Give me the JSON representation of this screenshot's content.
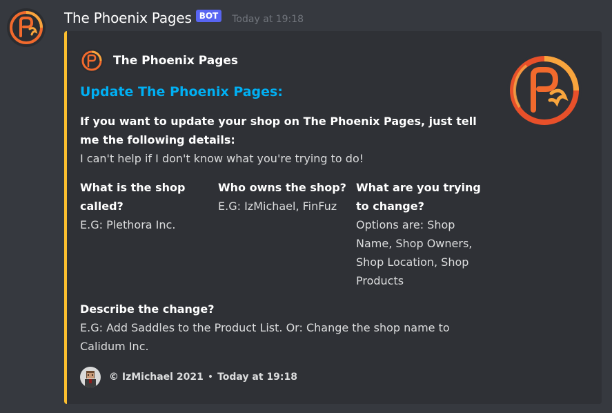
{
  "message": {
    "username": "The Phoenix Pages",
    "bot_tag": "BOT",
    "timestamp": "Today at 19:18"
  },
  "embed": {
    "accent_color": "#fcbf2f",
    "author_name": "The Phoenix Pages",
    "title": "Update The Phoenix Pages:",
    "intro_heading": "If you want to update your shop on The Phoenix Pages, just tell me the following details:",
    "intro_text": "I can't help if I don't know what you're trying to do!",
    "fields": [
      {
        "name": "What is the shop called?",
        "value": "E.G: Plethora Inc."
      },
      {
        "name": "Who owns the shop?",
        "value": "E.G: IzMichael, FinFuz"
      },
      {
        "name": "What are you trying to change?",
        "value": "Options are: Shop Name, Shop Owners, Shop Location, Shop Products"
      },
      {
        "name": "Describe the change?",
        "value": "E.G: Add Saddles to the Product List. Or: Change the shop name to Calidum Inc."
      }
    ],
    "footer_text": "© IzMichael 2021",
    "footer_separator": "•",
    "footer_timestamp": "Today at 19:18"
  },
  "icons": {
    "avatar": "phoenix-logo-icon",
    "author": "phoenix-logo-icon",
    "thumbnail": "phoenix-logo-icon",
    "footer": "user-avatar-icon"
  }
}
